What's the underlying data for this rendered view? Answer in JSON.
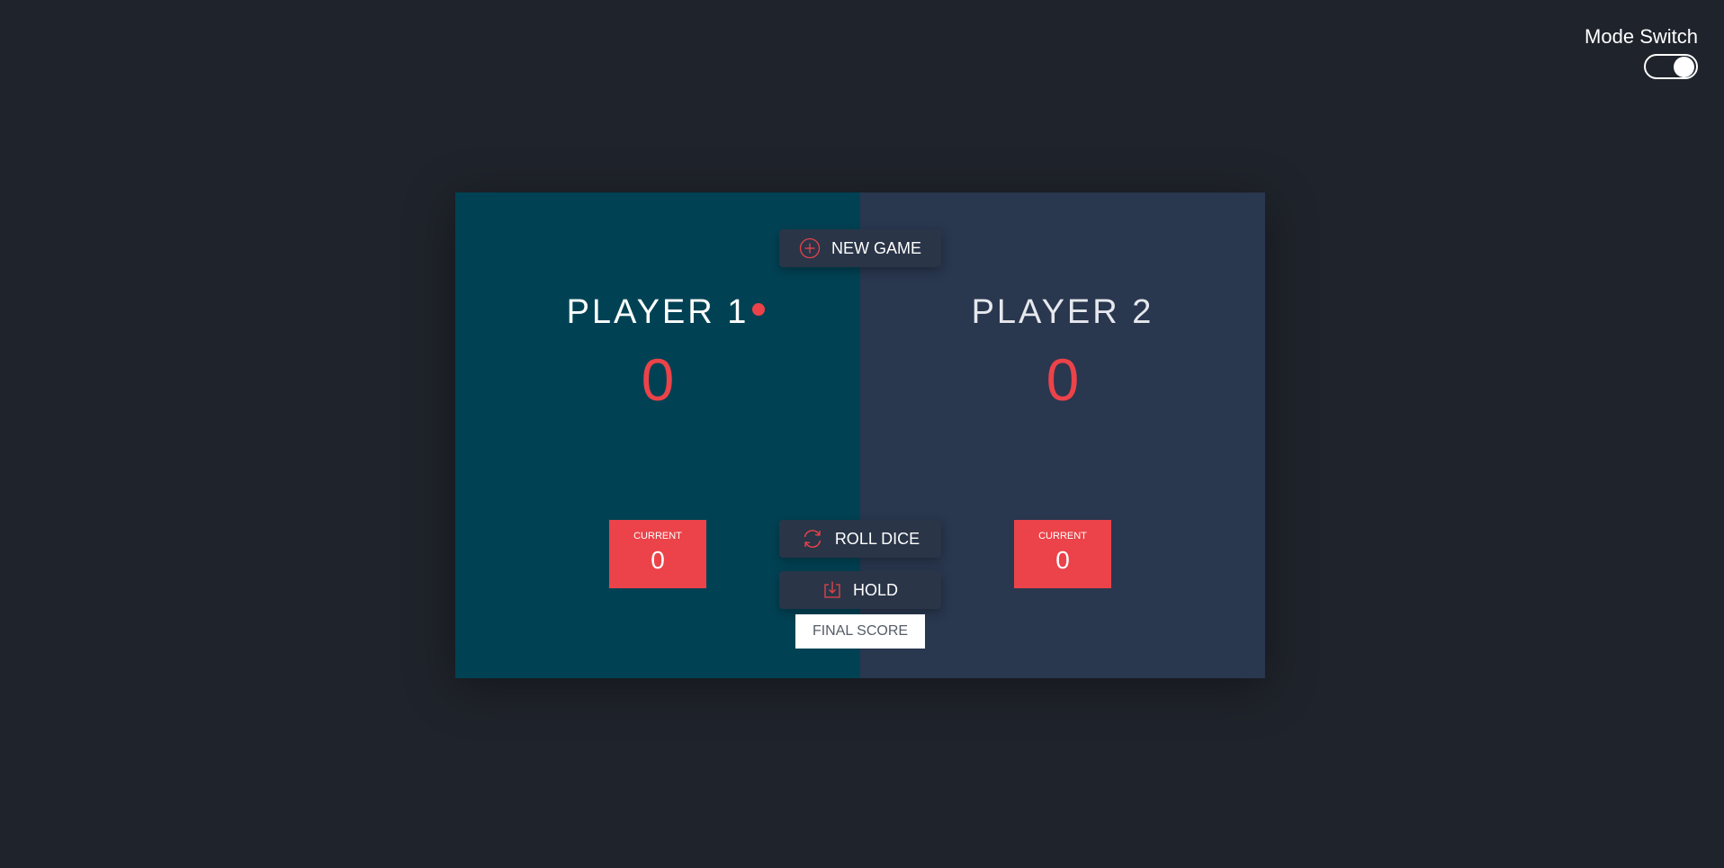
{
  "mode_switch": {
    "label": "Mode Switch",
    "state": "on"
  },
  "players": [
    {
      "name": "PLAYER 1",
      "score": "0",
      "current_label": "CURRENT",
      "current_score": "0",
      "active": true
    },
    {
      "name": "PLAYER 2",
      "score": "0",
      "current_label": "CURRENT",
      "current_score": "0",
      "active": false
    }
  ],
  "controls": {
    "new_game": {
      "label": "NEW GAME",
      "icon": "plus-circle-icon"
    },
    "roll_dice": {
      "label": "ROLL DICE",
      "icon": "refresh-icon"
    },
    "hold": {
      "label": "HOLD",
      "icon": "download-icon"
    },
    "final_score": {
      "placeholder": "FINAL SCORE"
    }
  },
  "colors": {
    "background": "#1f232b",
    "player1_panel": "#004254",
    "player2_panel": "#29374f",
    "accent": "#eb4349",
    "button": "#2a3548"
  }
}
